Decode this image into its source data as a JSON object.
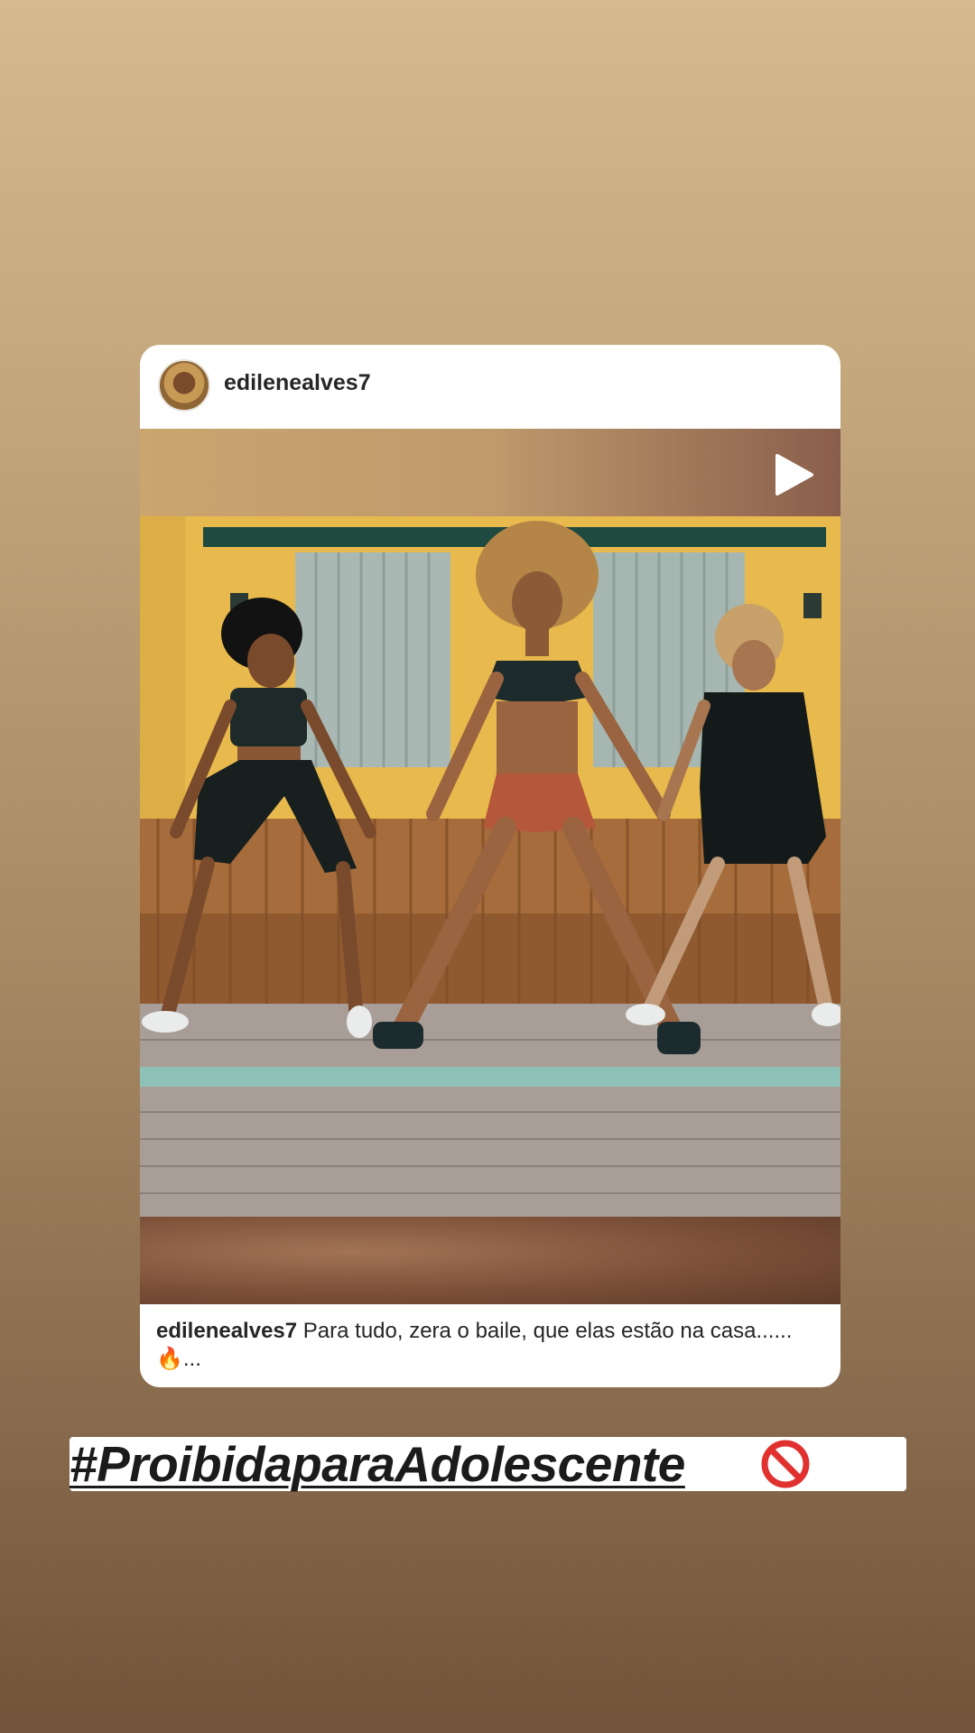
{
  "post": {
    "username": "edilenealves7",
    "caption_user": "edilenealves7",
    "caption_text": "Para tudo, zera o baile, que elas estão na casa......",
    "caption_emoji": "🔥",
    "caption_more": "...",
    "media_type": "video"
  },
  "story": {
    "hashtag": "#ProibidaparaAdolescente",
    "hashtag_icon": "prohibited-icon"
  },
  "icons": {
    "play": "play-icon",
    "fire": "fire-emoji-icon",
    "prohibited": "prohibited-icon"
  },
  "colors": {
    "background_top": "#d5ba8d",
    "background_bottom": "#715439",
    "card": "#ffffff",
    "text": "#262626",
    "prohibited_red": "#e0312f"
  }
}
